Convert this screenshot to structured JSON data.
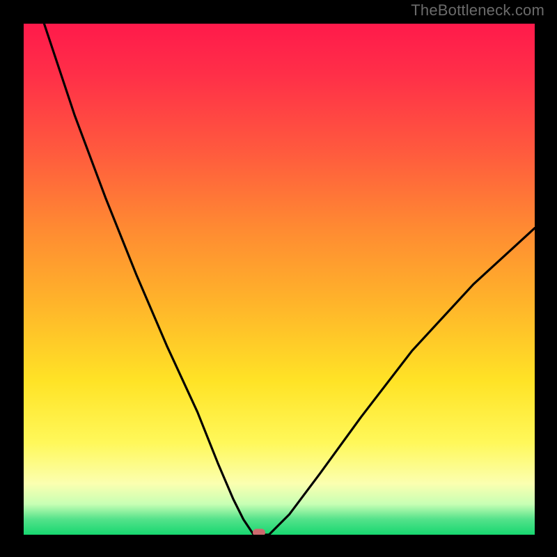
{
  "watermark": "TheBottleneck.com",
  "chart_data": {
    "type": "line",
    "title": "",
    "xlabel": "",
    "ylabel": "",
    "xlim": [
      0,
      100
    ],
    "ylim": [
      0,
      100
    ],
    "grid": false,
    "legend": false,
    "background_gradient": {
      "direction": "vertical",
      "stops": [
        {
          "pos": 0,
          "color": "#ff1a4b"
        },
        {
          "pos": 25,
          "color": "#ff5a3e"
        },
        {
          "pos": 55,
          "color": "#ffb52a"
        },
        {
          "pos": 82,
          "color": "#fff85a"
        },
        {
          "pos": 97,
          "color": "#53e28a"
        },
        {
          "pos": 100,
          "color": "#17d770"
        }
      ]
    },
    "series": [
      {
        "name": "bottleneck-curve",
        "x": [
          4,
          10,
          16,
          22,
          28,
          34,
          38,
          41,
          43,
          45,
          48,
          52,
          58,
          66,
          76,
          88,
          100
        ],
        "values": [
          100,
          82,
          66,
          51,
          37,
          24,
          14,
          7,
          3,
          0,
          0,
          4,
          12,
          23,
          36,
          49,
          60
        ]
      }
    ],
    "minimum_marker": {
      "x": 46,
      "y": 0,
      "color": "#cc6a6e"
    }
  }
}
